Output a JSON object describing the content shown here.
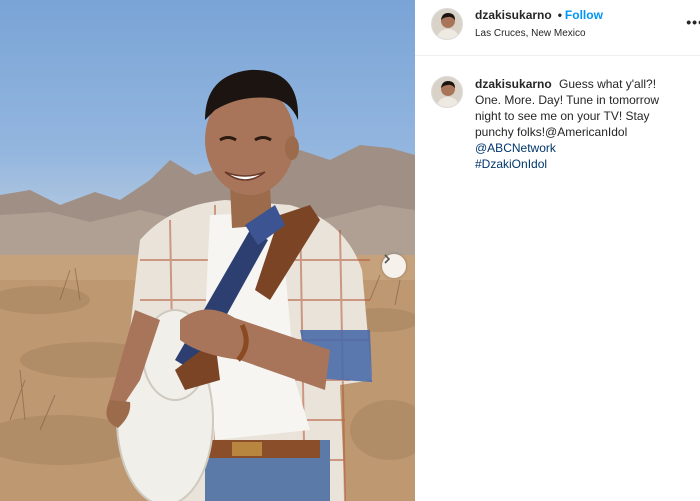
{
  "post": {
    "username": "dzakisukarno",
    "follow_label": "Follow",
    "separator": "•",
    "location": "Las Cruces, New Mexico",
    "more_label": "•••"
  },
  "caption": {
    "username": "dzakisukarno",
    "text": "Guess what y'all?! One. More. Day! Tune in tomorrow night to see me on your TV! Stay punchy folks!@AmericanIdol",
    "mention": "@ABCNetwork",
    "hashtag": "#DzakiOnIdol"
  },
  "photo": {
    "description_icon": "photo-of-man-with-guitar-in-desert",
    "next_icon": "chevron-right-icon"
  },
  "colors": {
    "follow": "#0095f6",
    "link": "#00376b",
    "text": "#262626"
  }
}
